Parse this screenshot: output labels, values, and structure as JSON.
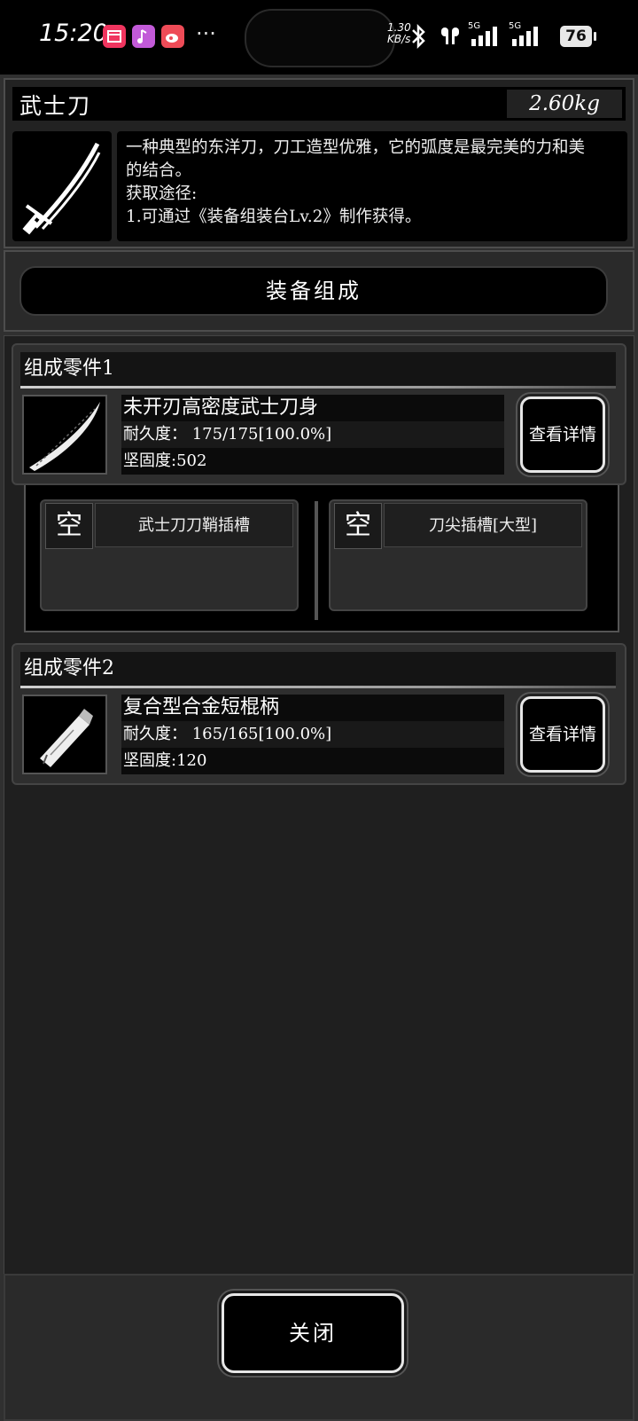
{
  "status_bar": {
    "time": "15:20",
    "net_speed_line1": "1.30",
    "net_speed_line2": "KB/s",
    "signal1_label": "5G",
    "signal2_label": "5G",
    "battery": "76",
    "overflow": "···",
    "app_icons": [
      "calendar-app-icon",
      "music-app-icon",
      "weibo-app-icon"
    ],
    "app_colors": [
      "#f0355f",
      "#c25ad8",
      "#ee4b57"
    ]
  },
  "item": {
    "name": "武士刀",
    "weight": "2.60kg",
    "description_lines": [
      "一种典型的东洋刀，刀工造型优雅，它的弧度是最完美的力和美",
      "的结合。",
      "获取途径:",
      "1.可通过《装备组装台Lv.2》制作获得。"
    ]
  },
  "section_header": "装备组成",
  "parts": [
    {
      "title": "组成零件1",
      "name": "未开刃高密度武士刀身",
      "durability": "耐久度： 175/175[100.0%]",
      "hardness": "坚固度:502",
      "detail_button": "查看详情",
      "icon": "blade-icon"
    },
    {
      "title": "组成零件2",
      "name": "复合型合金短棍柄",
      "durability": "耐久度： 165/165[100.0%]",
      "hardness": "坚固度:120",
      "detail_button": "查看详情",
      "icon": "handle-icon"
    }
  ],
  "slots": [
    {
      "status": "空",
      "label": "武士刀刀鞘插槽"
    },
    {
      "status": "空",
      "label": "刀尖插槽[大型]"
    }
  ],
  "close_button": "关闭"
}
